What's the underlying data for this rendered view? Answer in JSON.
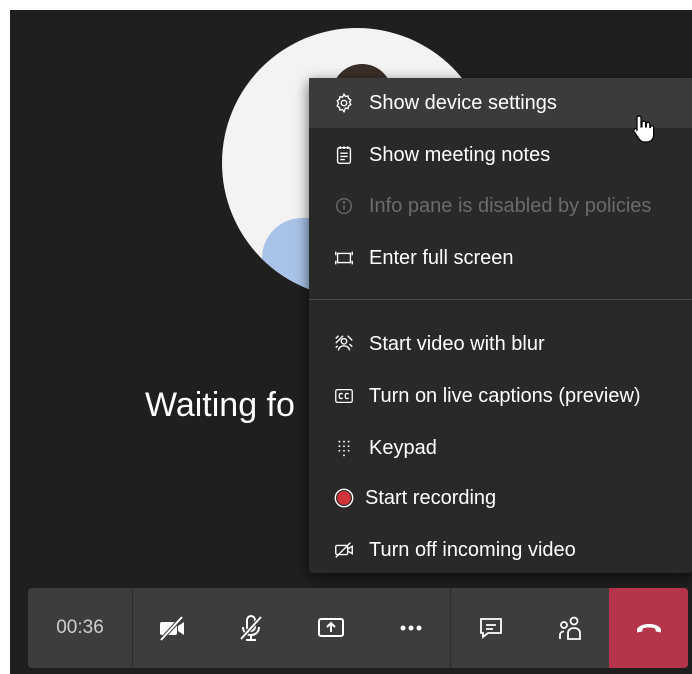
{
  "main": {
    "status_text": "Waiting fo"
  },
  "menu": {
    "items": [
      {
        "label": "Show device settings",
        "icon": "gear-icon",
        "state": "hover"
      },
      {
        "label": "Show meeting notes",
        "icon": "notes-icon"
      },
      {
        "label": "Info pane is disabled by policies",
        "icon": "info-icon",
        "state": "disabled"
      },
      {
        "label": "Enter full screen",
        "icon": "fullscreen-icon"
      },
      {
        "label": "Start video with blur",
        "icon": "blur-icon"
      },
      {
        "label": "Turn on live captions (preview)",
        "icon": "captions-icon"
      },
      {
        "label": "Keypad",
        "icon": "keypad-icon"
      },
      {
        "label": "Start recording",
        "icon": "record-icon",
        "icon_color": "#d13438"
      },
      {
        "label": "Turn off incoming video",
        "icon": "video-off-icon"
      }
    ]
  },
  "toolbar": {
    "timer": "00:36",
    "buttons": [
      "camera-off-icon",
      "mic-off-icon",
      "share-screen-icon",
      "more-icon",
      "chat-icon",
      "participants-icon",
      "hang-up-icon"
    ],
    "hangup_color": "#b4354a"
  }
}
